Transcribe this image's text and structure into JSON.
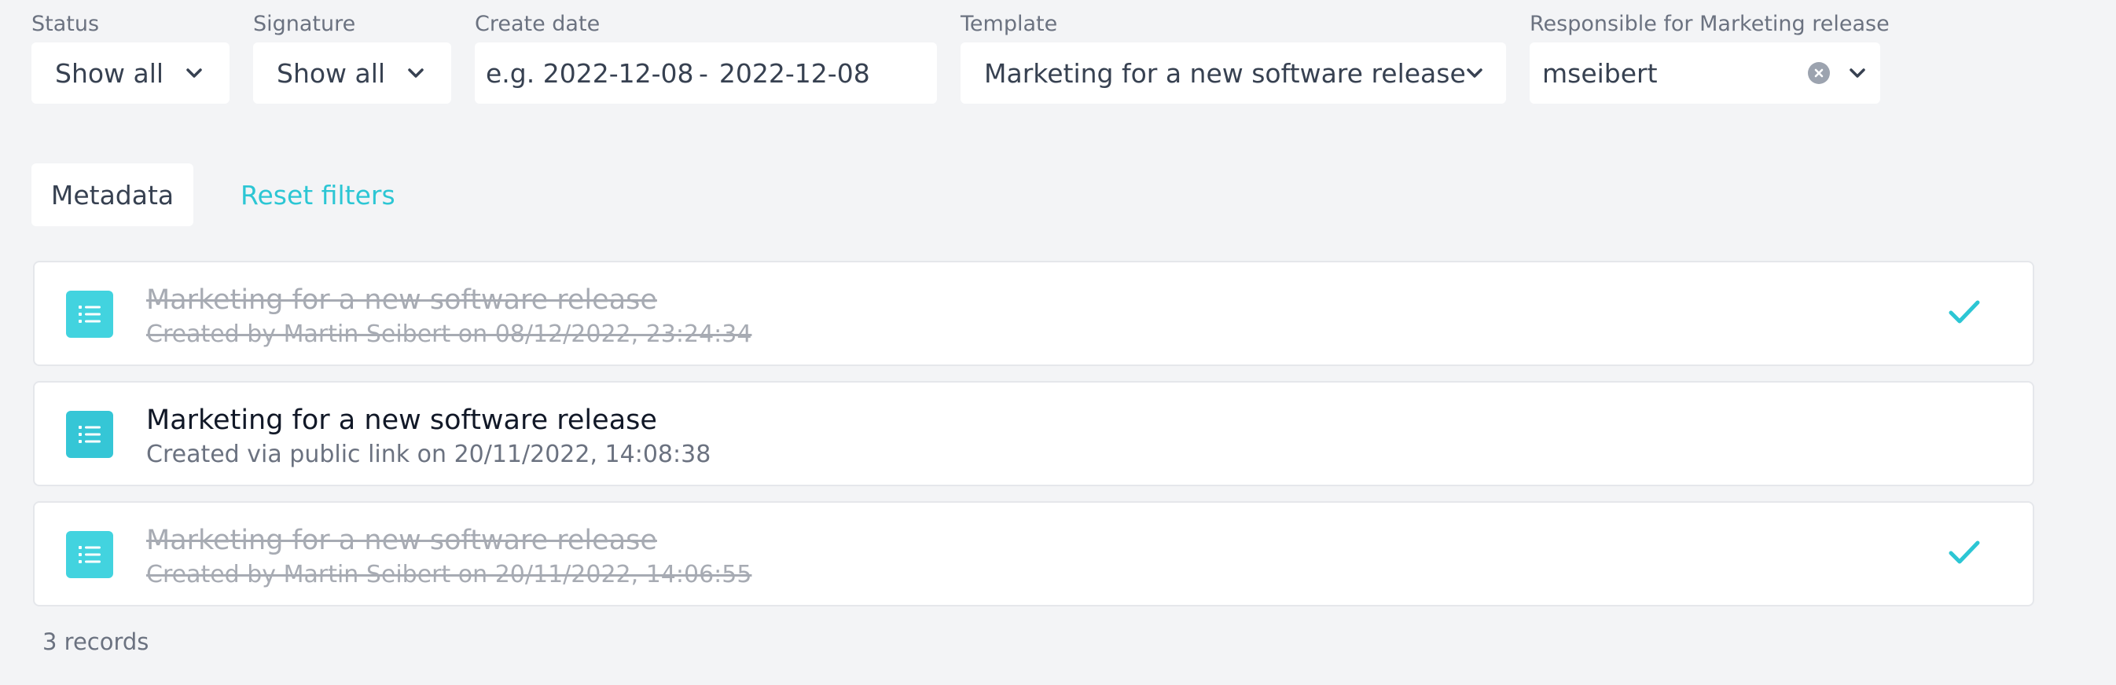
{
  "filters": {
    "status": {
      "label": "Status",
      "value": "Show all"
    },
    "signature": {
      "label": "Signature",
      "value": "Show all"
    },
    "create_date": {
      "label": "Create date",
      "from_placeholder": "e.g. 2022-12-08",
      "separator": "-",
      "to_value": "2022-12-08"
    },
    "template": {
      "label": "Template",
      "value": "Marketing for a new software release"
    },
    "responsible": {
      "label": "Responsible for Marketing release",
      "value": "mseibert"
    }
  },
  "actions": {
    "metadata_label": "Metadata",
    "reset_label": "Reset filters"
  },
  "records": [
    {
      "title": "Marketing for a new software release",
      "subtitle": "Created by Martin Seibert on 08/12/2022, 23:24:34",
      "done": true
    },
    {
      "title": "Marketing for a new software release",
      "subtitle": "Created via public link on 20/11/2022, 14:08:38",
      "done": false
    },
    {
      "title": "Marketing for a new software release",
      "subtitle": "Created by Martin Seibert on 20/11/2022, 14:06:55",
      "done": true
    }
  ],
  "records_count": "3 records",
  "colors": {
    "accent": "#2cc6d4",
    "background": "#f3f4f6",
    "done_text": "#a7abb3"
  },
  "icons": {
    "dropdown": "chevron-down-icon",
    "clear": "clear-icon",
    "record": "list-icon",
    "completed": "checkmark-icon"
  }
}
